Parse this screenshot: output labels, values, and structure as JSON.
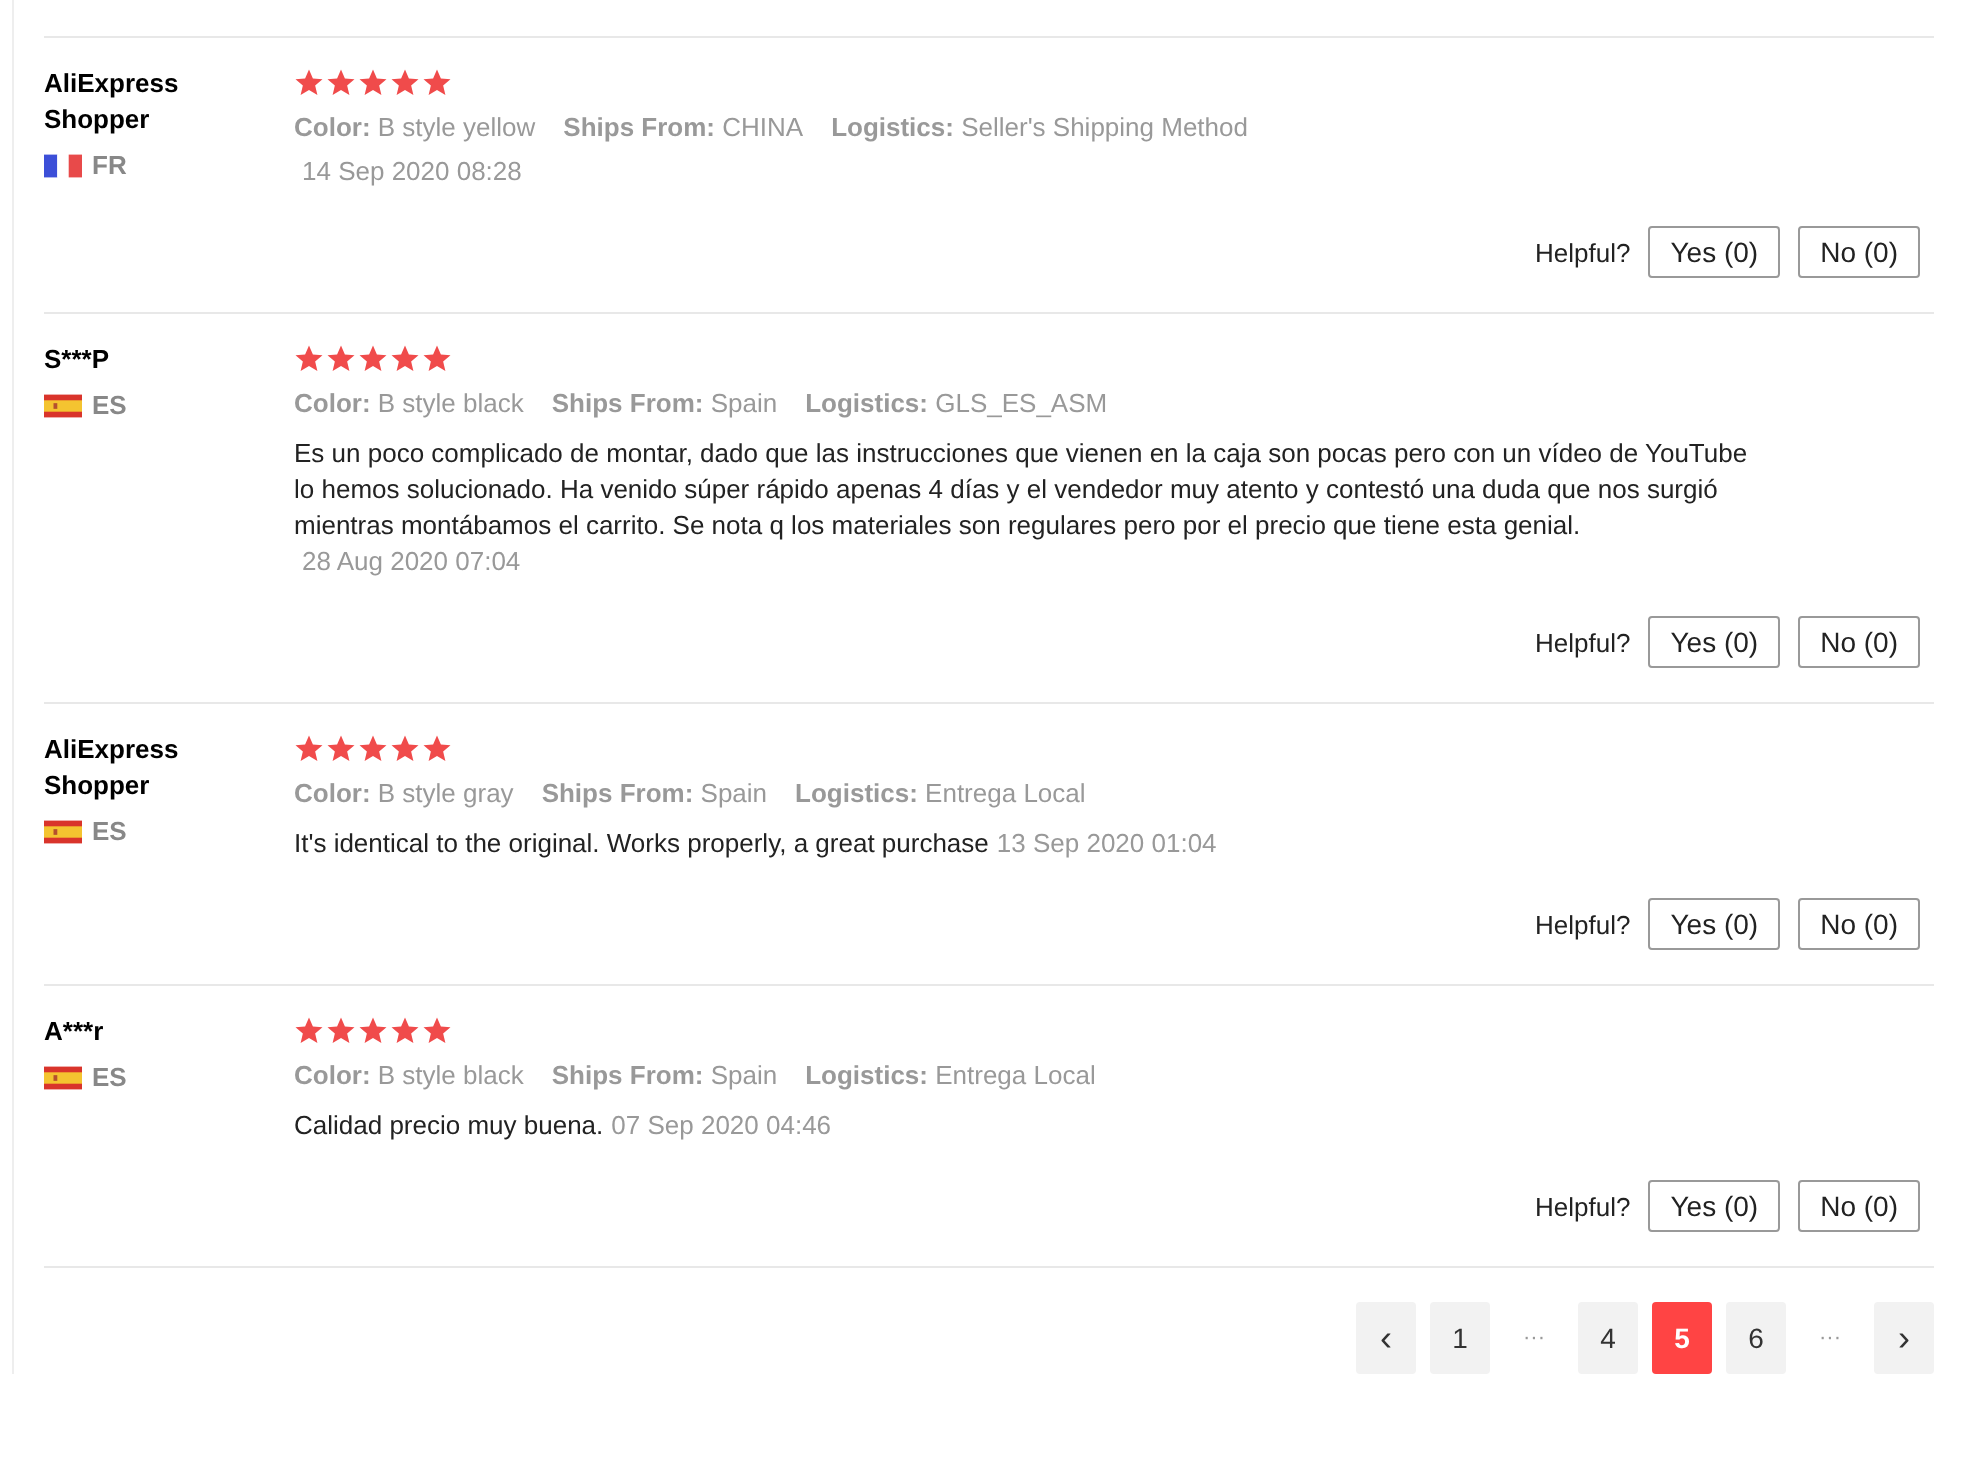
{
  "reviews": [
    {
      "name": "AliExpress Shopper",
      "flag": {
        "kind": "france"
      },
      "country": "FR",
      "stars": 5,
      "attributes": [
        {
          "label": "Color:",
          "value": "B style yellow"
        },
        {
          "label": "Ships From:",
          "value": "CHINA"
        },
        {
          "label": "Logistics:",
          "value": "Seller's Shipping Method"
        }
      ],
      "date": "14 Sep 2020 08:28",
      "helpful_label": "Helpful?",
      "yes": "Yes (0)",
      "no": "No (0)"
    },
    {
      "name": "S***P",
      "flag": {
        "kind": "spain"
      },
      "country": "ES",
      "stars": 5,
      "attributes": [
        {
          "label": "Color:",
          "value": "B style black"
        },
        {
          "label": "Ships From:",
          "value": "Spain"
        },
        {
          "label": "Logistics:",
          "value": "GLS_ES_ASM"
        }
      ],
      "text": "Es un poco complicado de montar, dado que las instrucciones que vienen en la caja son pocas pero con un vídeo de YouTube lo hemos solucionado. Ha venido súper rápido apenas 4 días y el vendedor muy atento y contestó una duda que nos surgió mientras montábamos el carrito. Se nota q los materiales son regulares pero por el precio que tiene esta genial.",
      "date": "28 Aug 2020 07:04",
      "helpful_label": "Helpful?",
      "yes": "Yes (0)",
      "no": "No (0)"
    },
    {
      "name": "AliExpress Shopper",
      "flag": {
        "kind": "spain"
      },
      "country": "ES",
      "stars": 5,
      "attributes": [
        {
          "label": "Color:",
          "value": "B style gray"
        },
        {
          "label": "Ships From:",
          "value": "Spain"
        },
        {
          "label": "Logistics:",
          "value": "Entrega Local"
        }
      ],
      "text": "It's identical to the original. Works properly, a great purchase",
      "date": "13 Sep 2020 01:04",
      "helpful_label": "Helpful?",
      "yes": "Yes (0)",
      "no": "No (0)"
    },
    {
      "name": "A***r",
      "flag": {
        "kind": "spain"
      },
      "country": "ES",
      "stars": 5,
      "attributes": [
        {
          "label": "Color:",
          "value": "B style black"
        },
        {
          "label": "Ships From:",
          "value": "Spain"
        },
        {
          "label": "Logistics:",
          "value": "Entrega Local"
        }
      ],
      "text": "Calidad precio muy buena.",
      "date": "07 Sep 2020 04:46",
      "helpful_label": "Helpful?",
      "yes": "Yes (0)",
      "no": "No (0)"
    }
  ],
  "pagination": {
    "prev": "‹",
    "next": "›",
    "items": [
      {
        "kind": "page",
        "label": "1",
        "selected": false
      },
      {
        "kind": "ellipsis",
        "label": "···"
      },
      {
        "kind": "page",
        "label": "4",
        "selected": false
      },
      {
        "kind": "page",
        "label": "5",
        "selected": true
      },
      {
        "kind": "page",
        "label": "6",
        "selected": false
      },
      {
        "kind": "ellipsis",
        "label": "···"
      }
    ]
  }
}
